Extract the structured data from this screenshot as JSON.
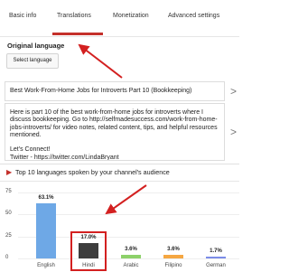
{
  "tabs": [
    {
      "label": "Basic info"
    },
    {
      "label": "Translations"
    },
    {
      "label": "Monetization"
    },
    {
      "label": "Advanced settings"
    }
  ],
  "original_language": {
    "heading": "Original language",
    "button_label": "Select language"
  },
  "title_field": {
    "value": "Best Work-From-Home Jobs for Introverts Part 10 (Bookkeeping)"
  },
  "description_field": {
    "value": "Here is part 10 of the best work-from-home jobs for introverts where I discuss bookkeeping. Go to http://selfmadesuccess.com/work-from-home-jobs-introverts/ for video notes, related content, tips, and helpful resources mentioned.\n\nLet's Connect!\nTwitter - https://twitter.com/LindaBryant"
  },
  "panel": {
    "title": "Top 10 languages spoken by your channel's audience",
    "icon": "youtube-logo-icon"
  },
  "colors": {
    "accent_red": "#c4302b",
    "english_bar": "#6ea8e6",
    "hindi_bar": "#3d3d3d",
    "arabic_bar": "#8dd16a",
    "filipino_bar": "#f5a742",
    "german_bar": "#7b8ce8"
  },
  "chart_data": {
    "type": "bar",
    "categories": [
      "English",
      "Hindi",
      "Arabic",
      "Filipino",
      "German"
    ],
    "values": [
      63.1,
      17.0,
      3.6,
      3.6,
      1.7
    ],
    "value_labels": [
      "63.1%",
      "17.0%",
      "3.6%",
      "3.6%",
      "1.7%"
    ],
    "yticks": [
      "75",
      "50",
      "25",
      "0"
    ],
    "ylim": [
      0,
      75
    ],
    "grid": true
  },
  "chevrons": [
    ">",
    ">"
  ]
}
